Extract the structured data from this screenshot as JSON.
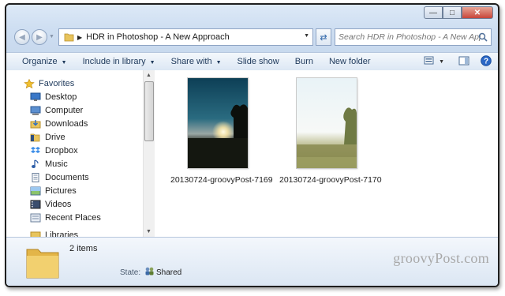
{
  "window": {
    "caption": {
      "minimize": "—",
      "maximize": "□",
      "close": "✕"
    }
  },
  "address": {
    "separator": "▶",
    "path": "HDR in Photoshop - A New Approach",
    "refresh_icon": "refresh-icon"
  },
  "search": {
    "placeholder": "Search HDR in Photoshop - A New Approach"
  },
  "toolbar": {
    "organize": "Organize",
    "include_in_library": "Include in library",
    "share_with": "Share with",
    "slide_show": "Slide show",
    "burn": "Burn",
    "new_folder": "New folder"
  },
  "sidebar": {
    "favorites": "Favorites",
    "items": [
      {
        "label": "Desktop",
        "icon": "desktop-icon"
      },
      {
        "label": "Computer",
        "icon": "computer-icon"
      },
      {
        "label": "Downloads",
        "icon": "downloads-icon"
      },
      {
        "label": "Drive",
        "icon": "drive-folder-icon"
      },
      {
        "label": "Dropbox",
        "icon": "dropbox-icon"
      },
      {
        "label": "Music",
        "icon": "music-icon"
      },
      {
        "label": "Documents",
        "icon": "documents-icon"
      },
      {
        "label": "Pictures",
        "icon": "pictures-icon"
      },
      {
        "label": "Videos",
        "icon": "videos-icon"
      },
      {
        "label": "Recent Places",
        "icon": "recent-places-icon"
      }
    ],
    "partial_item": "Libraries"
  },
  "files": [
    {
      "name": "20130724-groovyPost-7169"
    },
    {
      "name": "20130724-groovyPost-7170"
    }
  ],
  "details": {
    "count": "2 items",
    "state_label": "State:",
    "state_value": "Shared"
  },
  "watermark": "groovyPost.com",
  "colors": {
    "accent": "#1e395b",
    "toolbar_bg": "#dce7f4",
    "window_frame": "#cfdff2"
  }
}
